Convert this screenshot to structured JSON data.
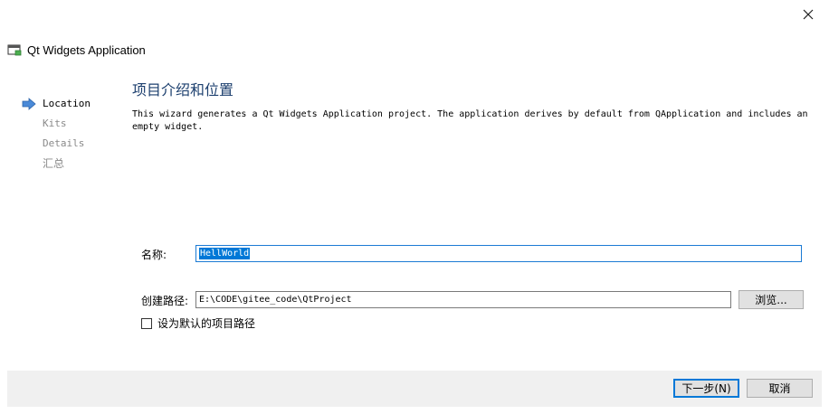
{
  "window": {
    "title": "Qt Widgets Application",
    "close_icon": "close-icon",
    "app_icon": "qt-app-icon"
  },
  "steps": [
    {
      "label": "Location",
      "active": true
    },
    {
      "label": "Kits",
      "active": false
    },
    {
      "label": "Details",
      "active": false
    },
    {
      "label": "汇总",
      "active": false
    }
  ],
  "page": {
    "title": "项目介绍和位置",
    "description": "This wizard generates a Qt Widgets Application project. The application derives by default from QApplication and includes an empty widget."
  },
  "form": {
    "name_label": "名称:",
    "name_value": "HellWorld",
    "path_label": "创建路径:",
    "path_value": "E:\\CODE\\gitee_code\\QtProject",
    "browse_label": "浏览...",
    "default_path_label": "设为默认的项目路径",
    "default_path_checked": false
  },
  "buttons": {
    "next": "下一步(N)",
    "cancel": "取消"
  },
  "colors": {
    "title": "#1c3f6e",
    "accent": "#0078d7",
    "footer_bg": "#f0f0f0",
    "active_arrow": "#4a8ad8"
  }
}
